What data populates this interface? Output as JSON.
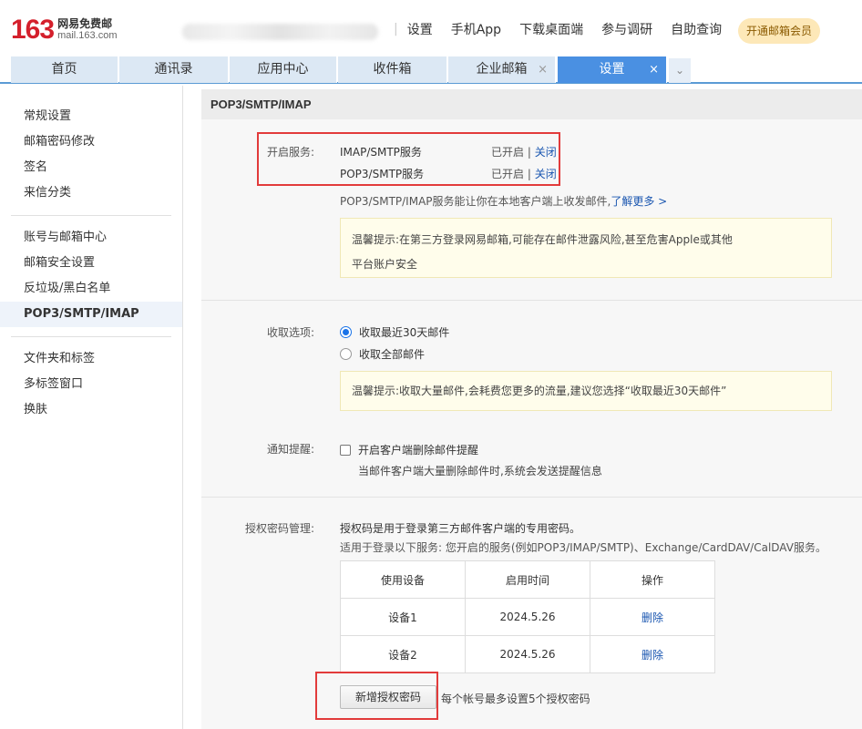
{
  "header": {
    "logo_num": "163",
    "logo_cn": "网易免费邮",
    "logo_en": "mail.163.com",
    "links": [
      "设置",
      "手机App",
      "下载桌面端",
      "参与调研",
      "自助查询"
    ],
    "vip_label": "开通邮箱会员"
  },
  "tabs": [
    {
      "label": "首页",
      "active": false,
      "closable": false
    },
    {
      "label": "通讯录",
      "active": false,
      "closable": false
    },
    {
      "label": "应用中心",
      "active": false,
      "closable": false
    },
    {
      "label": "收件箱",
      "active": false,
      "closable": false
    },
    {
      "label": "企业邮箱",
      "active": false,
      "closable": true
    },
    {
      "label": "设置",
      "active": true,
      "closable": true
    }
  ],
  "tab_close": "×",
  "tab_more": "⌄",
  "sidebar": {
    "group1": [
      "常规设置",
      "邮箱密码修改",
      "签名",
      "来信分类"
    ],
    "group2": [
      "账号与邮箱中心",
      "邮箱安全设置",
      "反垃圾/黑白名单",
      "POP3/SMTP/IMAP"
    ],
    "group3": [
      "文件夹和标签",
      "多标签窗口",
      "换肤"
    ],
    "active": "POP3/SMTP/IMAP"
  },
  "main": {
    "section_title": "POP3/SMTP/IMAP",
    "services": {
      "label": "开启服务:",
      "rows": [
        {
          "name": "IMAP/SMTP服务",
          "status": "已开启",
          "sep": " | ",
          "action": "关闭"
        },
        {
          "name": "POP3/SMTP服务",
          "status": "已开启",
          "sep": " | ",
          "action": "关闭"
        }
      ],
      "desc": "POP3/SMTP/IMAP服务能让你在本地客户端上收发邮件,",
      "more": "了解更多 >",
      "tip_line1": "温馨提示:在第三方登录网易邮箱,可能存在邮件泄露风险,甚至危害Apple或其他",
      "tip_line2": "平台账户安全"
    },
    "receive": {
      "label": "收取选项:",
      "options": [
        {
          "label": "收取最近30天邮件",
          "selected": true
        },
        {
          "label": "收取全部邮件",
          "selected": false
        }
      ],
      "tip": "温馨提示:收取大量邮件,会耗费您更多的流量,建议您选择“收取最近30天邮件”"
    },
    "notify": {
      "label": "通知提醒:",
      "checkbox_label": "开启客户端删除邮件提醒",
      "checked": false,
      "sub": "当邮件客户端大量删除邮件时,系统会发送提醒信息"
    },
    "auth": {
      "label": "授权密码管理:",
      "desc1": "授权码是用于登录第三方邮件客户端的专用密码。",
      "desc2": "适用于登录以下服务: 您开启的服务(例如POP3/IMAP/SMTP)、Exchange/CardDAV/CalDAV服务。",
      "table_headers": [
        "使用设备",
        "启用时间",
        "操作"
      ],
      "rows": [
        {
          "device": "设备1",
          "date": "2024.5.26",
          "action": "删除"
        },
        {
          "device": "设备2",
          "date": "2024.5.26",
          "action": "删除"
        }
      ],
      "add_button": "新增授权密码",
      "add_note": "每个帐号最多设置5个授权密码"
    }
  },
  "colors": {
    "brand_red": "#d4202c",
    "tab_active": "#4a90e2",
    "highlight_box": "#e23b3b",
    "link": "#1a56b0"
  }
}
